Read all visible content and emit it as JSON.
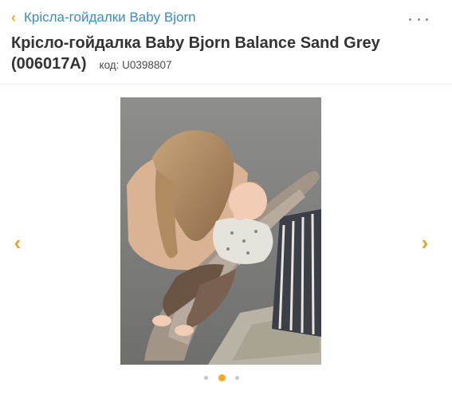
{
  "header": {
    "breadcrumb_label": "Крісла-гойдалки Baby Bjorn",
    "title": "Крісло-гойдалка Baby Bjorn Balance Sand Grey (006017A)",
    "code_label": "код: U0398807"
  },
  "gallery": {
    "image_alt": "mother leaning over baby in sand-grey bouncer chair",
    "prev_arrow": "‹",
    "next_arrow": "›",
    "dot_count": 3,
    "active_dot": 2
  },
  "colors": {
    "accent": "#f0a81e",
    "link": "#3a8cc4",
    "title": "#333333"
  }
}
